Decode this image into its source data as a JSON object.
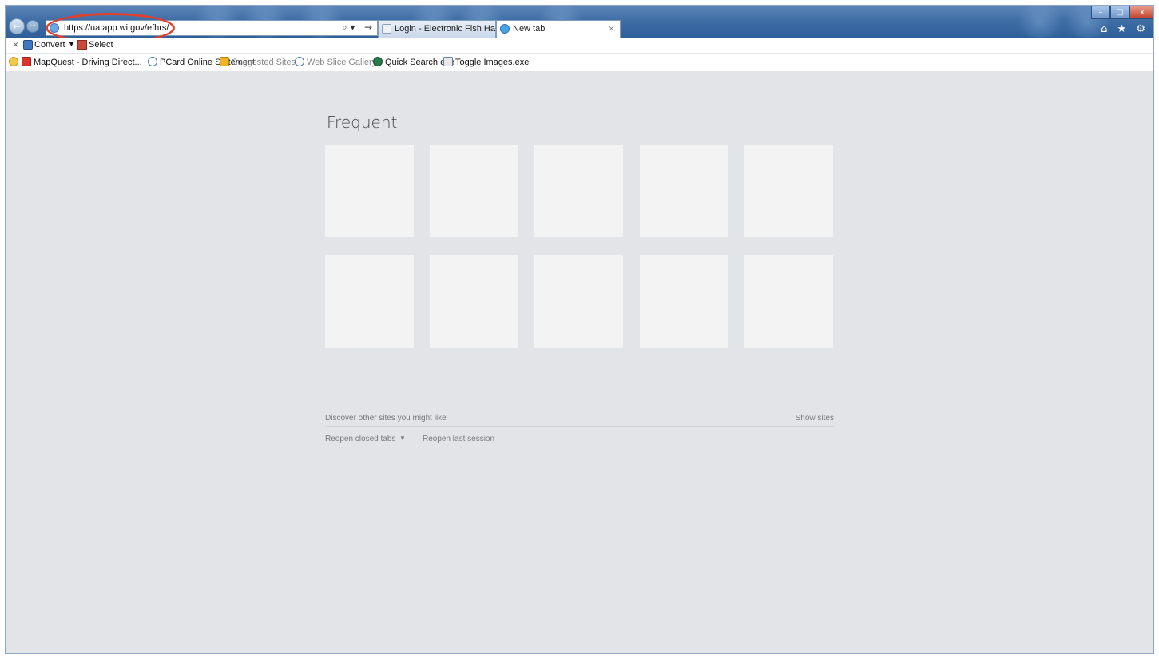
{
  "browser": {
    "address_url": "https://uatapp.wi.gov/efhrs/",
    "search_glyph": "⌕ ▾",
    "go_glyph": "→",
    "back_glyph": "←",
    "forward_glyph": "→",
    "tabs": [
      {
        "label": "Login - Electronic Fish Harvest ...",
        "close": ""
      },
      {
        "label": "New tab",
        "close": "×"
      }
    ],
    "window_controls": {
      "minimize": "–",
      "maximize": "□",
      "close": "x"
    },
    "right_icons": {
      "home": "⌂",
      "favorites": "★",
      "tools": "⚙"
    }
  },
  "command_bar": {
    "close": "×",
    "convert": "Convert",
    "convert_dropdown": "▼",
    "select": "Select"
  },
  "favorites_bar": {
    "items": [
      {
        "label": "MapQuest - Driving Direct...",
        "icon": "mapquest-icon"
      },
      {
        "label": "PCard Online Statement",
        "icon": "ie-page-icon"
      },
      {
        "label": "Suggested Sites ▾",
        "icon": "bing-icon"
      },
      {
        "label": "Web Slice Gallery ▾",
        "icon": "ie-page-icon"
      },
      {
        "label": "Quick Search.exe",
        "icon": "quick-search-icon"
      },
      {
        "label": "Toggle Images.exe",
        "icon": "toggle-images-icon"
      }
    ]
  },
  "new_tab_page": {
    "frequent_title": "Frequent",
    "tile_count": 10,
    "discover_text": "Discover other sites you might like",
    "show_sites": "Show sites",
    "reopen_closed": "Reopen closed tabs",
    "reopen_dropdown": "▼",
    "reopen_last": "Reopen last session"
  },
  "colors": {
    "content_bg": "#e3e4e8",
    "tile_bg": "#f3f3f3",
    "title_bar": "#3f6ea6",
    "highlight_ring": "#e0402c"
  }
}
